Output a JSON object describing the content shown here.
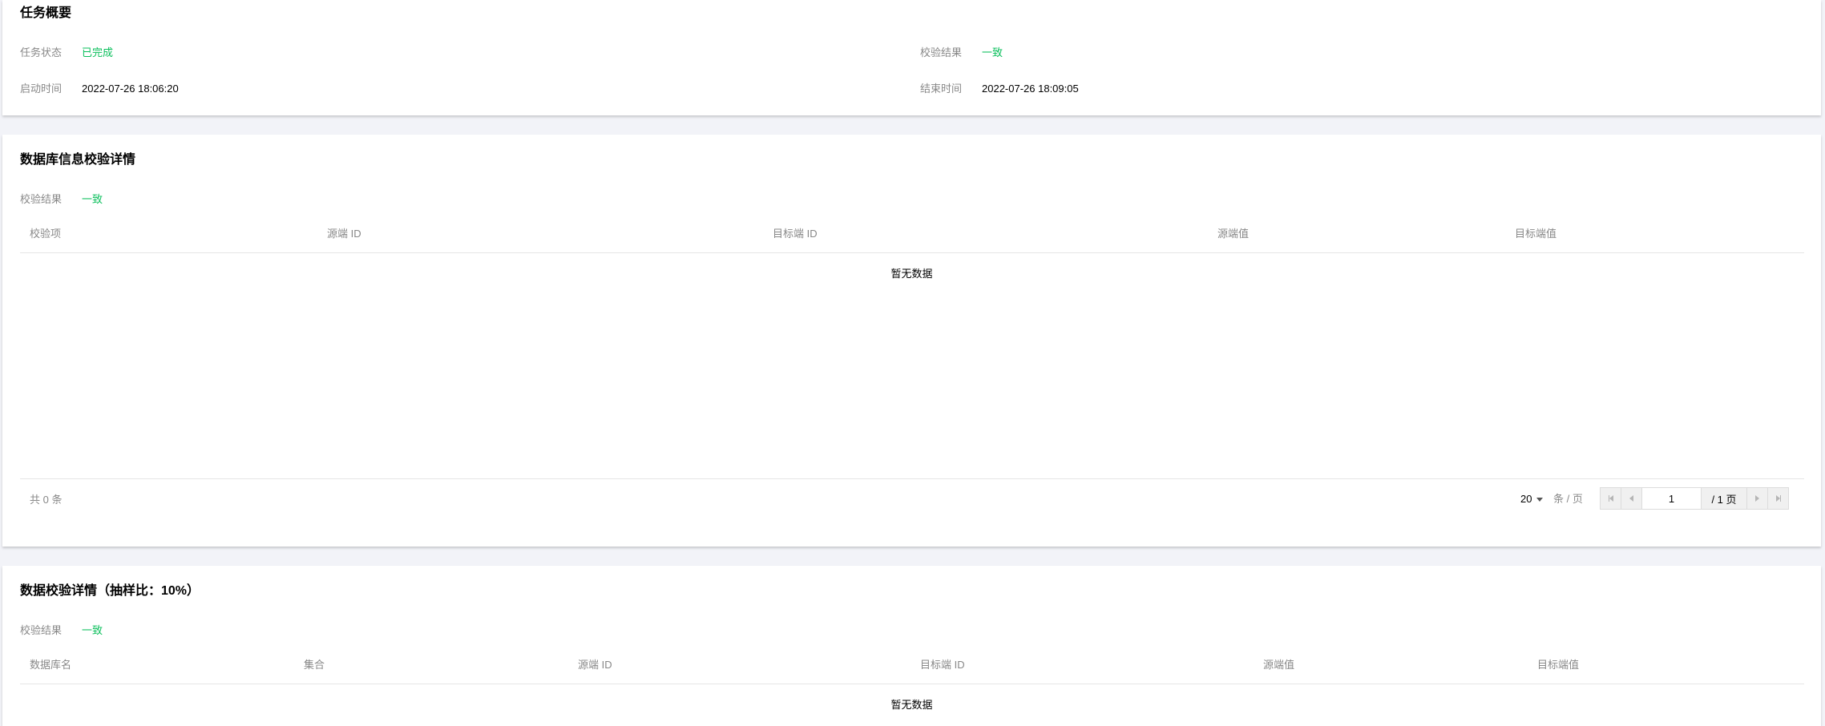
{
  "summary": {
    "title": "任务概要",
    "status_label": "任务状态",
    "status_value": "已完成",
    "result_label": "校验结果",
    "result_value": "一致",
    "start_label": "启动时间",
    "start_value": "2022-07-26 18:06:20",
    "end_label": "结束时间",
    "end_value": "2022-07-26 18:09:05"
  },
  "db_info": {
    "title": "数据库信息校验详情",
    "result_label": "校验结果",
    "result_value": "一致",
    "columns": [
      "校验项",
      "源端 ID",
      "目标端 ID",
      "源端值",
      "目标端值"
    ],
    "rows": [],
    "empty_text": "暂无数据",
    "pagination": {
      "total_text": "共 0 条",
      "page_size": "20",
      "page_size_unit": "条 / 页",
      "current_page": "1",
      "page_count_text": "/ 1 页"
    }
  },
  "data_check": {
    "title": "数据校验详情（抽样比：10%）",
    "result_label": "校验结果",
    "result_value": "一致",
    "columns": [
      "数据库名",
      "集合",
      "源端 ID",
      "目标端 ID",
      "源端值",
      "目标端值"
    ],
    "rows": [],
    "empty_text": "暂无数据"
  },
  "colors": {
    "success": "#0abf5b",
    "label": "#888888",
    "background": "#f2f3f8"
  }
}
